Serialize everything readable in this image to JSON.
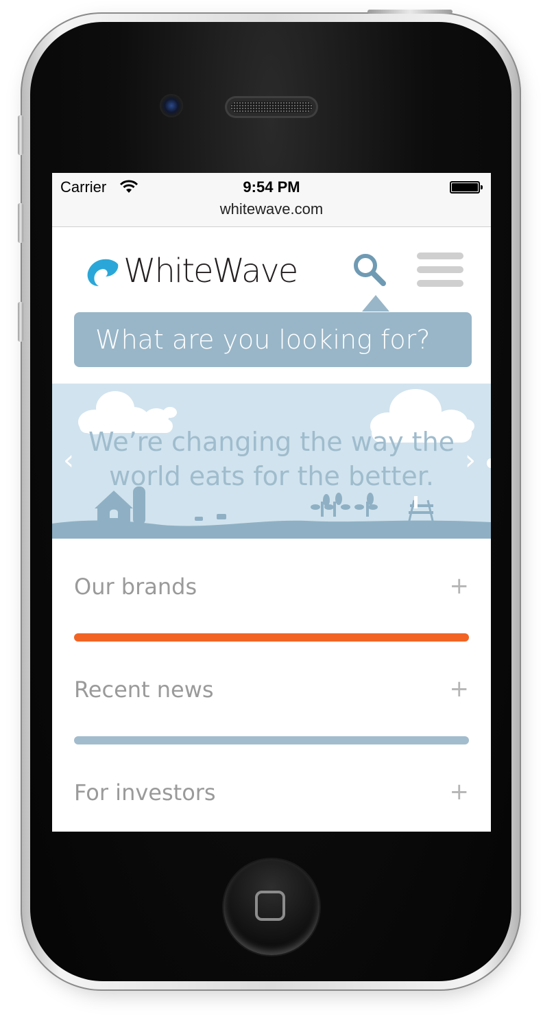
{
  "status_bar": {
    "carrier": "Carrier",
    "time": "9:54 PM",
    "battery_level": 1.0
  },
  "browser": {
    "url": "whitewave.com"
  },
  "header": {
    "logo_text": "WhiteWave"
  },
  "search": {
    "placeholder": "What are you looking for?"
  },
  "hero": {
    "line1": "We’re changing the way the",
    "line2": "world eats for the better.",
    "prev_arrow": "‹",
    "next_arrow": "›"
  },
  "accordion": {
    "items": [
      {
        "label": "Our brands",
        "toggle": "+"
      },
      {
        "label": "Recent news",
        "toggle": "+"
      },
      {
        "label": "For investors",
        "toggle": "+"
      }
    ]
  },
  "colors": {
    "brand_blue": "#2aa7d8",
    "accent_orange": "#f26424",
    "slate_blue": "#99b6c8",
    "hero_sky": "#d1e3ee"
  },
  "icons": [
    "wifi-icon",
    "battery-icon",
    "logo-wave-icon",
    "search-icon",
    "hamburger-menu-icon",
    "chevron-left-icon",
    "chevron-right-icon"
  ]
}
